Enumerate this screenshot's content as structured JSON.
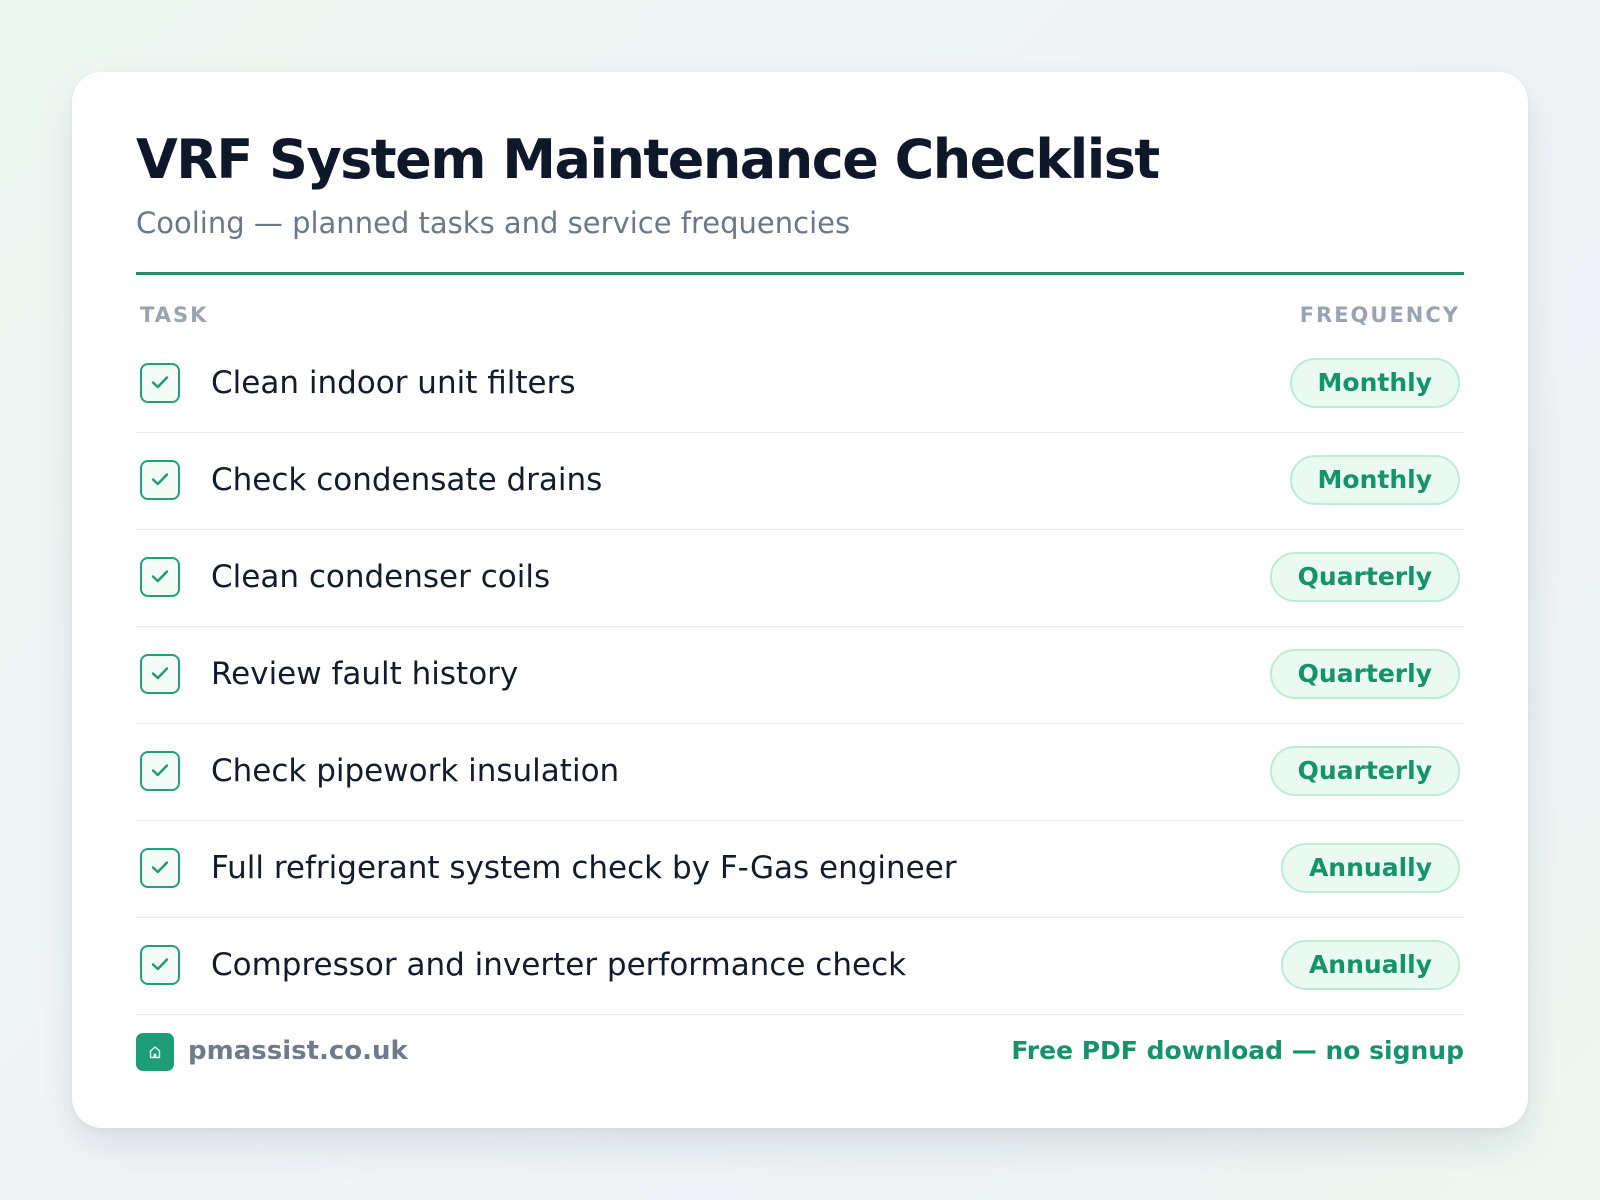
{
  "header": {
    "title": "VRF System Maintenance Checklist",
    "subtitle": "Cooling — planned tasks and service frequencies"
  },
  "columns": {
    "task": "TASK",
    "frequency": "FREQUENCY"
  },
  "tasks": [
    {
      "label": "Clean indoor unit filters",
      "frequency": "Monthly",
      "checked": true
    },
    {
      "label": "Check condensate drains",
      "frequency": "Monthly",
      "checked": true
    },
    {
      "label": "Clean condenser coils",
      "frequency": "Quarterly",
      "checked": true
    },
    {
      "label": "Review fault history",
      "frequency": "Quarterly",
      "checked": true
    },
    {
      "label": "Check pipework insulation",
      "frequency": "Quarterly",
      "checked": true
    },
    {
      "label": "Full refrigerant system check by F-Gas engineer",
      "frequency": "Annually",
      "checked": true
    },
    {
      "label": "Compressor and inverter performance check",
      "frequency": "Annually",
      "checked": true
    }
  ],
  "footer": {
    "site": "pmassist.co.uk",
    "logo_icon": "house-icon",
    "download_link": "Free PDF download — no signup"
  },
  "colors": {
    "accent": "#1f8f6a",
    "badge_bg": "#eafaf2",
    "badge_border": "#bdecd6",
    "badge_text": "#15936b",
    "title": "#0f172a"
  }
}
